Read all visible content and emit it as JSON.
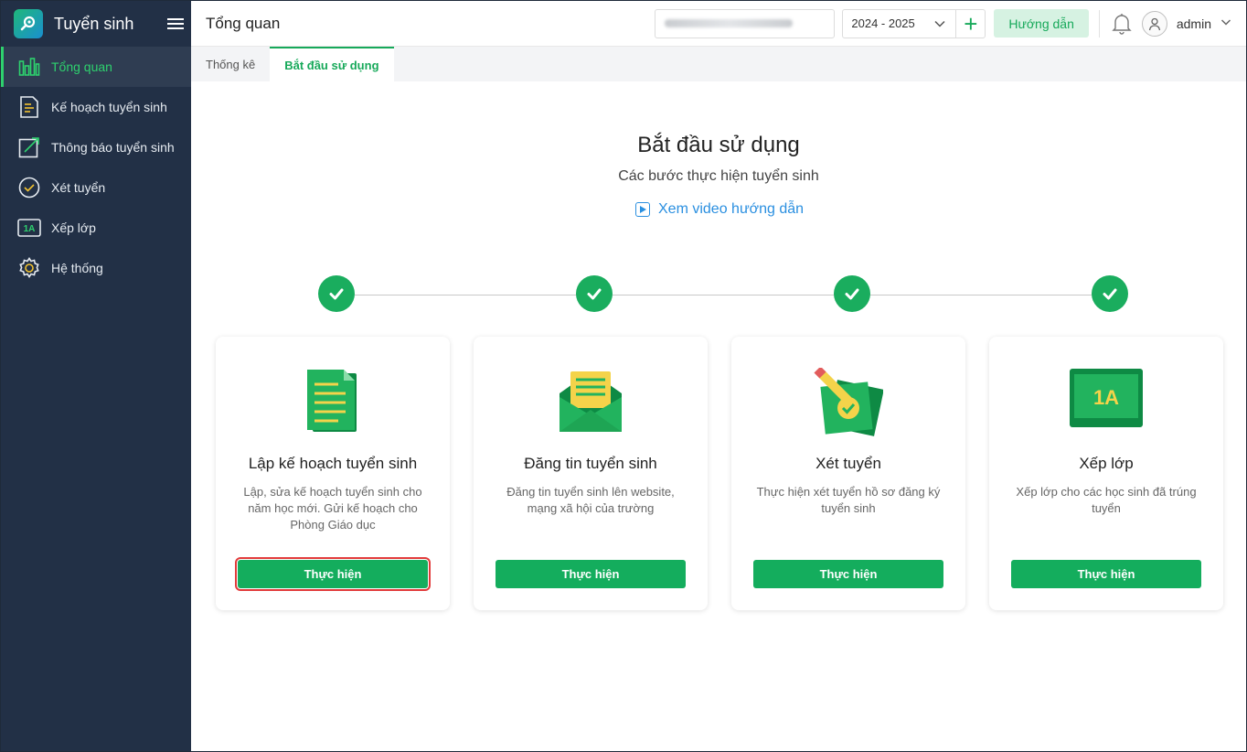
{
  "app": {
    "title": "Tuyển sinh"
  },
  "sidebar": {
    "items": [
      {
        "label": "Tổng quan",
        "icon": "chart-bars-icon",
        "active": true
      },
      {
        "label": "Kế hoạch tuyển sinh",
        "icon": "document-icon"
      },
      {
        "label": "Thông báo tuyển sinh",
        "icon": "edit-arrow-icon"
      },
      {
        "label": "Xét tuyển",
        "icon": "check-circle-icon"
      },
      {
        "label": "Xếp lớp",
        "icon": "class-1a-icon",
        "icon_text": "1A"
      },
      {
        "label": "Hệ thống",
        "icon": "gear-icon"
      }
    ]
  },
  "header": {
    "page_title": "Tổng quan",
    "school_year": "2024 - 2025",
    "add_label": "+",
    "guide_label": "Hướng dẫn",
    "user": "admin"
  },
  "tabs": [
    {
      "label": "Thống kê",
      "active": false
    },
    {
      "label": "Bắt đầu sử dụng",
      "active": true
    }
  ],
  "main": {
    "title": "Bắt đầu sử dụng",
    "subtitle": "Các bước thực hiện tuyển sinh",
    "video_link": "Xem video hướng dẫn",
    "cards": [
      {
        "title": "Lập kế hoạch tuyển sinh",
        "desc": "Lập, sửa kế hoạch tuyển sinh cho năm học mới. Gửi kế hoạch cho Phòng Giáo dục",
        "button": "Thực hiện",
        "icon": "plan-document-icon"
      },
      {
        "title": "Đăng tin tuyển sinh",
        "desc": "Đăng tin tuyển sinh lên website, mạng xã hội của trường",
        "button": "Thực hiện",
        "icon": "envelope-letter-icon"
      },
      {
        "title": "Xét tuyển",
        "desc": "Thực hiện xét tuyển hồ sơ đăng ký tuyển sinh",
        "button": "Thực hiện",
        "icon": "review-pencil-icon"
      },
      {
        "title": "Xếp lớp",
        "desc": "Xếp lớp cho các học sinh đã trúng tuyển",
        "button": "Thực hiện",
        "icon": "classroom-board-icon",
        "icon_text": "1A"
      }
    ]
  },
  "colors": {
    "primary": "#14ad5d",
    "sidebar_bg": "#223046",
    "link": "#2a8fe0",
    "highlight": "#e23b3b"
  }
}
